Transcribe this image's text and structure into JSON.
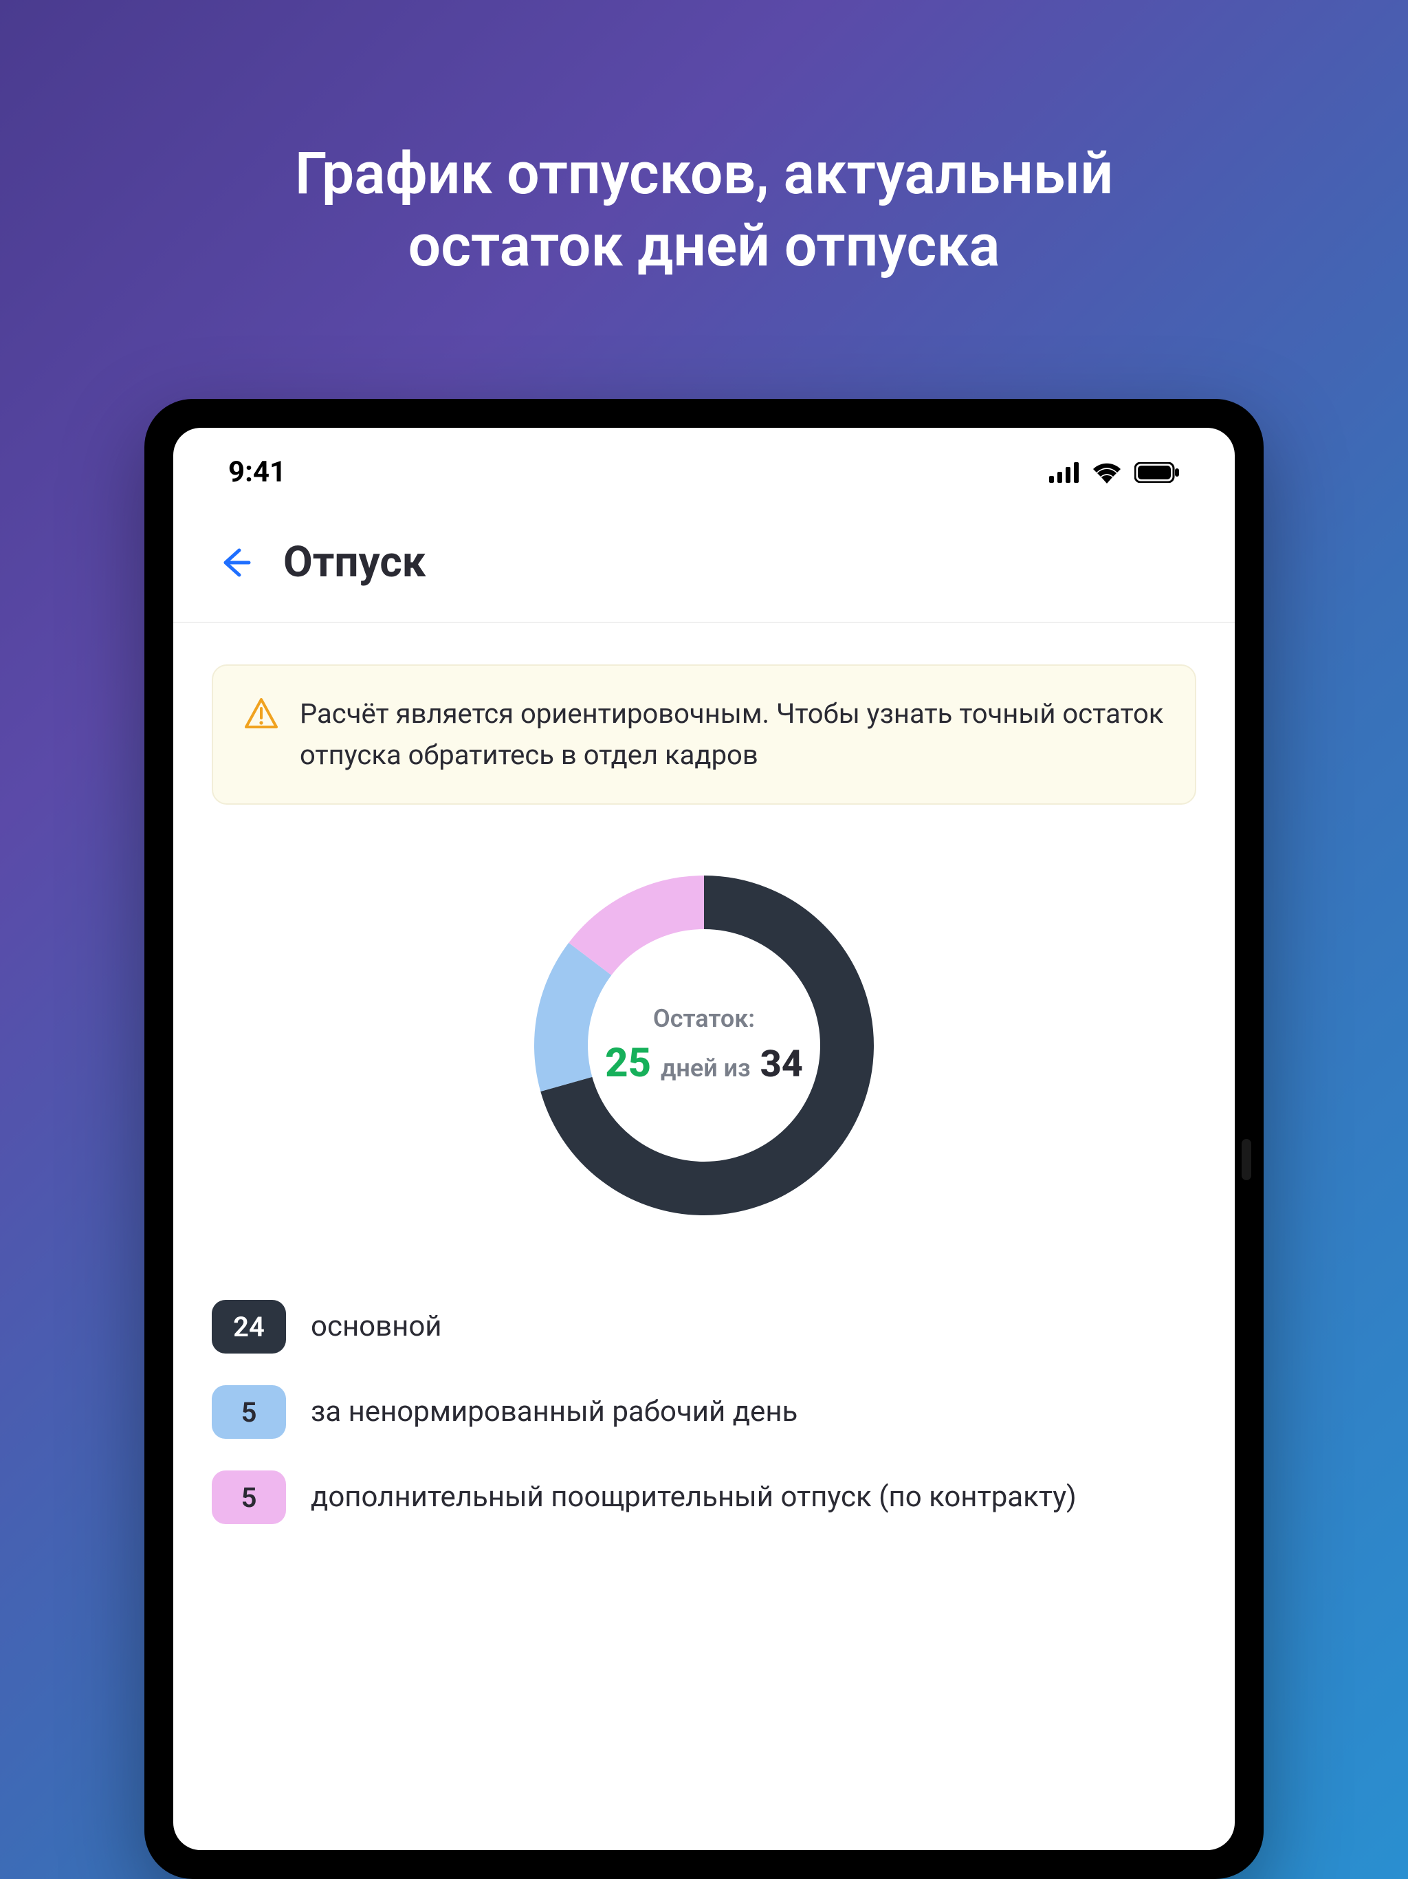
{
  "promo": {
    "line1": "График отпусков, актуальный",
    "line2": "остаток дней отпуска"
  },
  "status": {
    "time": "9:41"
  },
  "header": {
    "title": "Отпуск"
  },
  "notice": {
    "text": "Расчёт является ориентировочным. Чтобы узнать точный остаток отпуска обратитесь в отдел кадров"
  },
  "donut": {
    "label": "Остаток:",
    "remaining": "25",
    "middle": "дней из",
    "total": "34"
  },
  "legend": {
    "items": [
      {
        "value": "24",
        "label": "основной",
        "color": "#2c3440",
        "text_color": "#ffffff"
      },
      {
        "value": "5",
        "label": "за ненормированный рабочий день",
        "color": "#9ec8f2",
        "text_color": "#2a2a33"
      },
      {
        "value": "5",
        "label": "дополнительный поощрительный отпуск (по контракту)",
        "color": "#efb7ef",
        "text_color": "#2a2a33"
      }
    ]
  },
  "chart_data": {
    "type": "pie",
    "title": "Остаток дней отпуска",
    "series": [
      {
        "name": "основной",
        "value": 24,
        "color": "#2c3440"
      },
      {
        "name": "за ненормированный рабочий день",
        "value": 5,
        "color": "#9ec8f2"
      },
      {
        "name": "дополнительный поощрительный отпуск (по контракту)",
        "value": 5,
        "color": "#efb7ef"
      }
    ],
    "total": 34,
    "remaining": 25,
    "center_label": "Остаток:",
    "center_middle": "дней из"
  }
}
